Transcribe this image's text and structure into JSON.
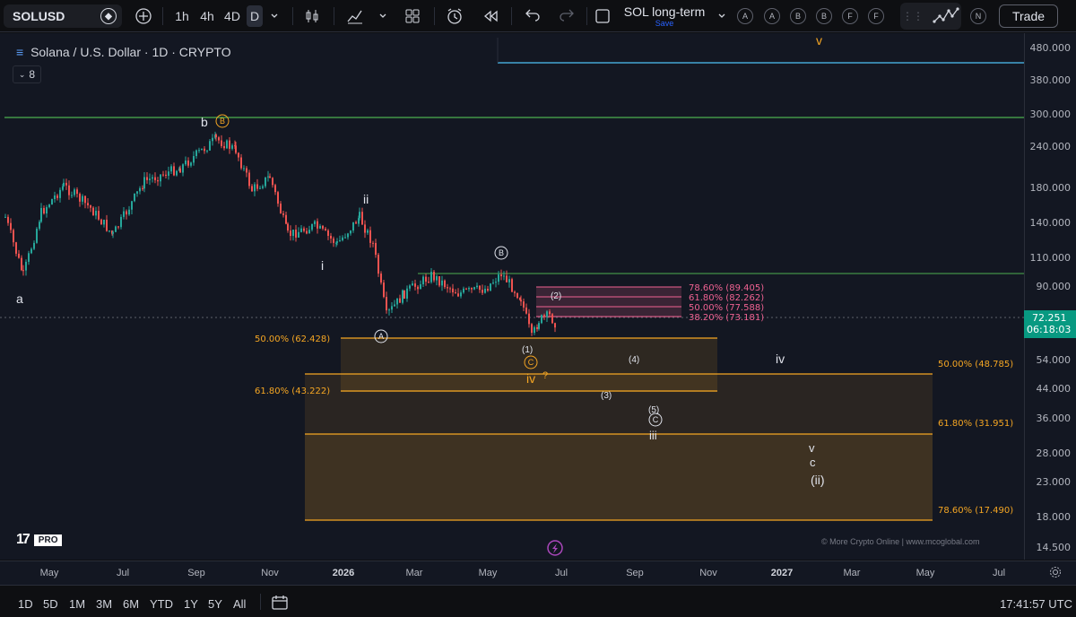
{
  "toolbar": {
    "symbol": "SOLUSD",
    "intervals": [
      "1h",
      "4h",
      "4D",
      "D"
    ],
    "active_interval": "D",
    "layout_name": "SOL long-term",
    "layout_sub": "Save",
    "drawing_letters": [
      "A",
      "A",
      "B",
      "B",
      "F",
      "F"
    ],
    "n_label": "N",
    "trade_label": "Trade",
    "icons": [
      "add-symbol-icon",
      "chevron-down-icon",
      "candles-icon",
      "indicators-icon",
      "templates-icon",
      "alert-icon",
      "replay-icon",
      "undo-icon",
      "redo-icon",
      "layout-square-icon",
      "grid-dots-icon",
      "wave-icon"
    ]
  },
  "legend": {
    "title": "Solana / U.S. Dollar · 1D · CRYPTO",
    "indicators_count": "8"
  },
  "price_axis": {
    "ticks": [
      "480.000",
      "380.000",
      "300.000",
      "240.000",
      "180.000",
      "140.000",
      "110.000",
      "90.000",
      "72.251",
      "54.000",
      "44.000",
      "36.000",
      "28.000",
      "23.000",
      "18.000",
      "14.500"
    ],
    "last_price": "72.251",
    "countdown": "06:18:03"
  },
  "time_axis": {
    "ticks": [
      "May",
      "Jul",
      "Sep",
      "Nov",
      "2026",
      "Mar",
      "May",
      "Jul",
      "Sep",
      "Nov",
      "2027",
      "Mar",
      "May",
      "Jul"
    ],
    "bold_ticks": [
      "2026",
      "2027"
    ]
  },
  "bottom_bar": {
    "ranges": [
      "1D",
      "5D",
      "1M",
      "3M",
      "6M",
      "YTD",
      "1Y",
      "5Y",
      "All"
    ],
    "clock": "17:41:57 UTC"
  },
  "annotations": {
    "waves": [
      "a",
      "b",
      "B",
      "ii",
      "i",
      "B",
      "A",
      "(1)",
      "(2)",
      "C",
      "iv",
      "?",
      "(4)",
      "(3)",
      "(5)",
      "C",
      "iii",
      "iv",
      "v",
      "c",
      "(ii)",
      "v"
    ],
    "fib_left": [
      {
        "label": "50.00% (62.428)"
      },
      {
        "label": "61.80% (43.222)"
      }
    ],
    "fib_right": [
      {
        "label": "50.00% (48.785)"
      },
      {
        "label": "61.80% (31.951)"
      },
      {
        "label": "78.60% (17.490)"
      }
    ],
    "fib_pink": [
      {
        "label": "78.60% (89.405)"
      },
      {
        "label": "61.80% (82.262)"
      },
      {
        "label": "50.00% (77.588)"
      },
      {
        "label": "38.20% (73.181)"
      }
    ]
  },
  "branding": {
    "logo_text": "17",
    "pro_badge": "PRO",
    "watermark": "© More Crypto Online  |  www.mcoglobal.com"
  },
  "colors": {
    "background": "#131722",
    "up": "#26a69a",
    "down": "#ef5350",
    "fib_orange": "#f5a623",
    "fib_pink": "#f06292",
    "green_line": "#4caf50",
    "cyan_line": "#4fc3f7"
  }
}
